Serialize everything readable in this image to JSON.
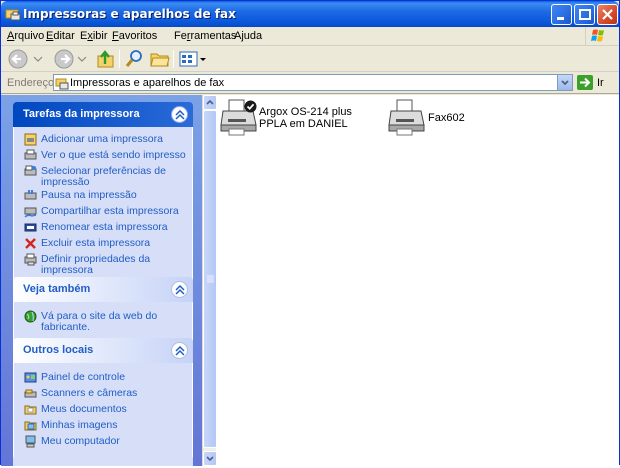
{
  "window": {
    "title": "Impressoras e aparelhos de fax"
  },
  "menu": [
    {
      "label": "Arquivo",
      "accel": "A"
    },
    {
      "label": "Editar",
      "accel": "E"
    },
    {
      "label": "Exibir",
      "accel": "x"
    },
    {
      "label": "Favoritos",
      "accel": "F"
    },
    {
      "label": "Ferramentas",
      "accel": "r"
    },
    {
      "label": "Ajuda",
      "accel": "j"
    }
  ],
  "address": {
    "label": "Endereço",
    "value": "Impressoras e aparelhos de fax",
    "go_label": "Ir"
  },
  "taskpane": {
    "printer_tasks": {
      "title": "Tarefas da impressora",
      "items": [
        {
          "label": "Adicionar uma impressora",
          "icon": "add-printer-icon"
        },
        {
          "label": "Ver o que está sendo impresso",
          "icon": "print-queue-icon"
        },
        {
          "label": "Selecionar preferências de impressão",
          "icon": "preferences-icon"
        },
        {
          "label": "Pausa na impressão",
          "icon": "pause-icon"
        },
        {
          "label": "Compartilhar esta impressora",
          "icon": "share-icon"
        },
        {
          "label": "Renomear esta impressora",
          "icon": "rename-icon"
        },
        {
          "label": "Excluir esta impressora",
          "icon": "delete-icon"
        },
        {
          "label": "Definir propriedades da impressora",
          "icon": "properties-icon"
        }
      ]
    },
    "see_also": {
      "title": "Veja também",
      "items": [
        {
          "label": "Vá para o site da web do fabricante.",
          "icon": "web-icon"
        }
      ]
    },
    "other_places": {
      "title": "Outros locais",
      "items": [
        {
          "label": "Painel de controle",
          "icon": "control-panel-icon"
        },
        {
          "label": "Scanners e câmeras",
          "icon": "scanner-icon"
        },
        {
          "label": "Meus documentos",
          "icon": "folder-icon"
        },
        {
          "label": "Minhas imagens",
          "icon": "pictures-icon"
        },
        {
          "label": "Meu computador",
          "icon": "computer-icon"
        }
      ]
    }
  },
  "printers": [
    {
      "name": "Argox OS-214 plus PPLA em DANIEL",
      "default": true,
      "selected": true
    },
    {
      "name": "Fax602",
      "default": false,
      "selected": false
    }
  ],
  "colors": {
    "titlebar": "#0a5fd8",
    "link": "#215dc6",
    "panel_body": "#d6dff7",
    "taskpane_bg": "#7ba2e7"
  }
}
